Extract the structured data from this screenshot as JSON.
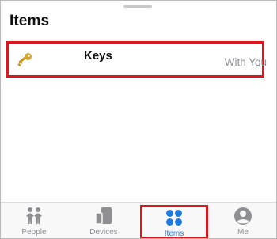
{
  "header": {
    "title": "Items"
  },
  "items": [
    {
      "name": "Keys",
      "status": "With You",
      "icon": "key-icon"
    }
  ],
  "tabbar": {
    "tabs": [
      {
        "label": "People",
        "icon": "people-icon",
        "active": false
      },
      {
        "label": "Devices",
        "icon": "devices-icon",
        "active": false
      },
      {
        "label": "Items",
        "icon": "items-icon",
        "active": true
      },
      {
        "label": "Me",
        "icon": "me-icon",
        "active": false
      }
    ]
  },
  "colors": {
    "accent": "#1f7ae0",
    "highlight_border": "#d9171d",
    "inactive_tab": "#8e8e93",
    "key_gold": "#d7a52a"
  }
}
